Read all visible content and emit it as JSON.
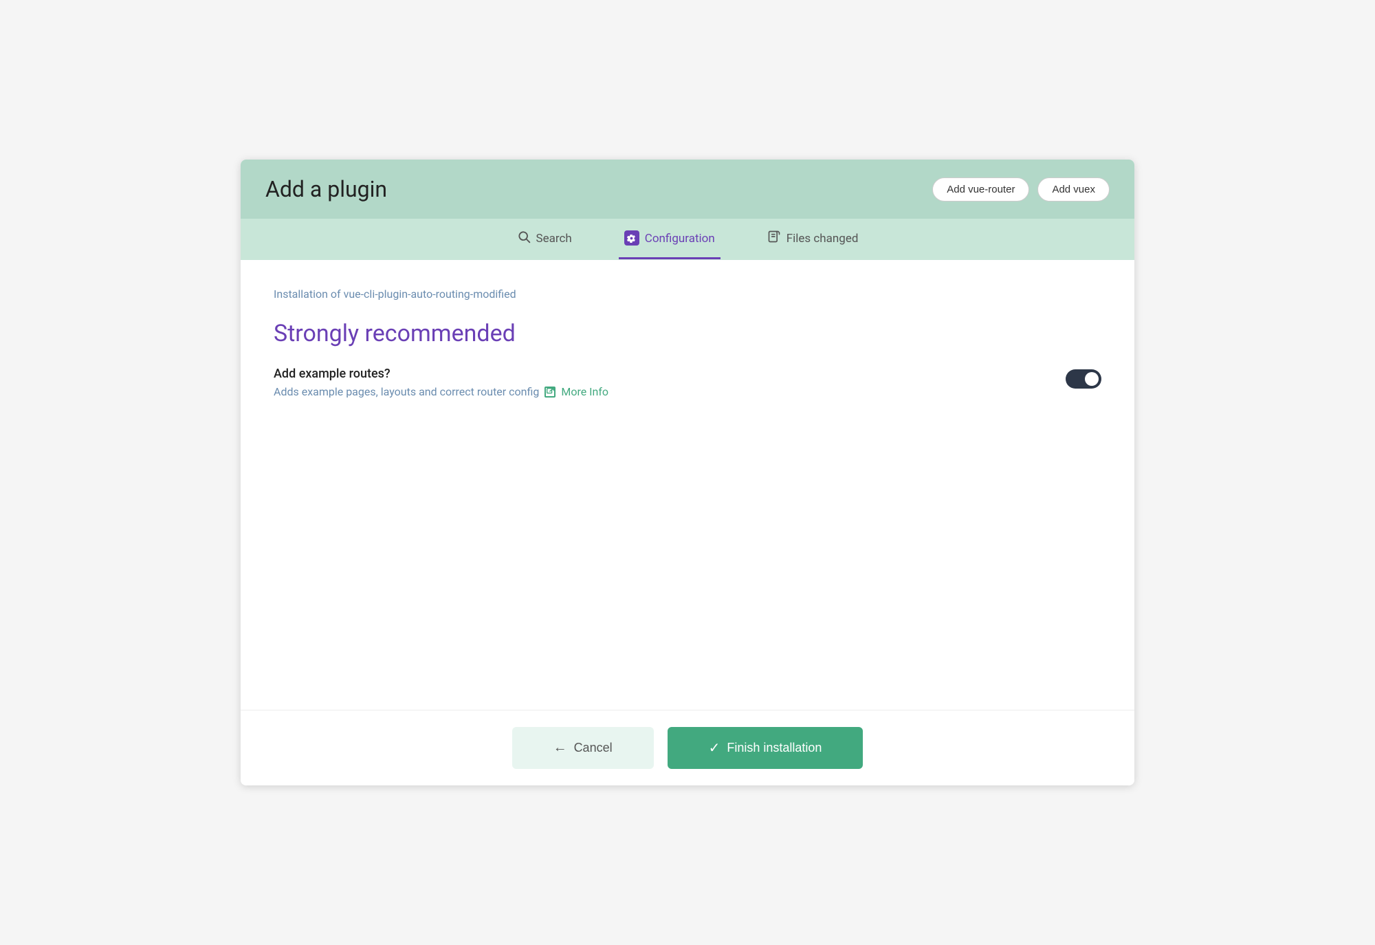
{
  "header": {
    "title": "Add a plugin",
    "btn_add_router": "Add vue-router",
    "btn_add_vuex": "Add vuex"
  },
  "tabs": {
    "search": {
      "label": "Search",
      "icon": "search-icon"
    },
    "configuration": {
      "label": "Configuration",
      "icon": "config-icon",
      "active": true
    },
    "files_changed": {
      "label": "Files changed",
      "icon": "files-icon"
    }
  },
  "content": {
    "subtitle": "Installation of vue-cli-plugin-auto-routing-modified",
    "section_title": "Strongly recommended",
    "option": {
      "label": "Add example routes?",
      "description": "Adds example pages, layouts and correct router config",
      "more_info_label": "More Info",
      "toggle_state": "on"
    }
  },
  "footer": {
    "cancel_label": "Cancel",
    "finish_label": "Finish installation"
  }
}
